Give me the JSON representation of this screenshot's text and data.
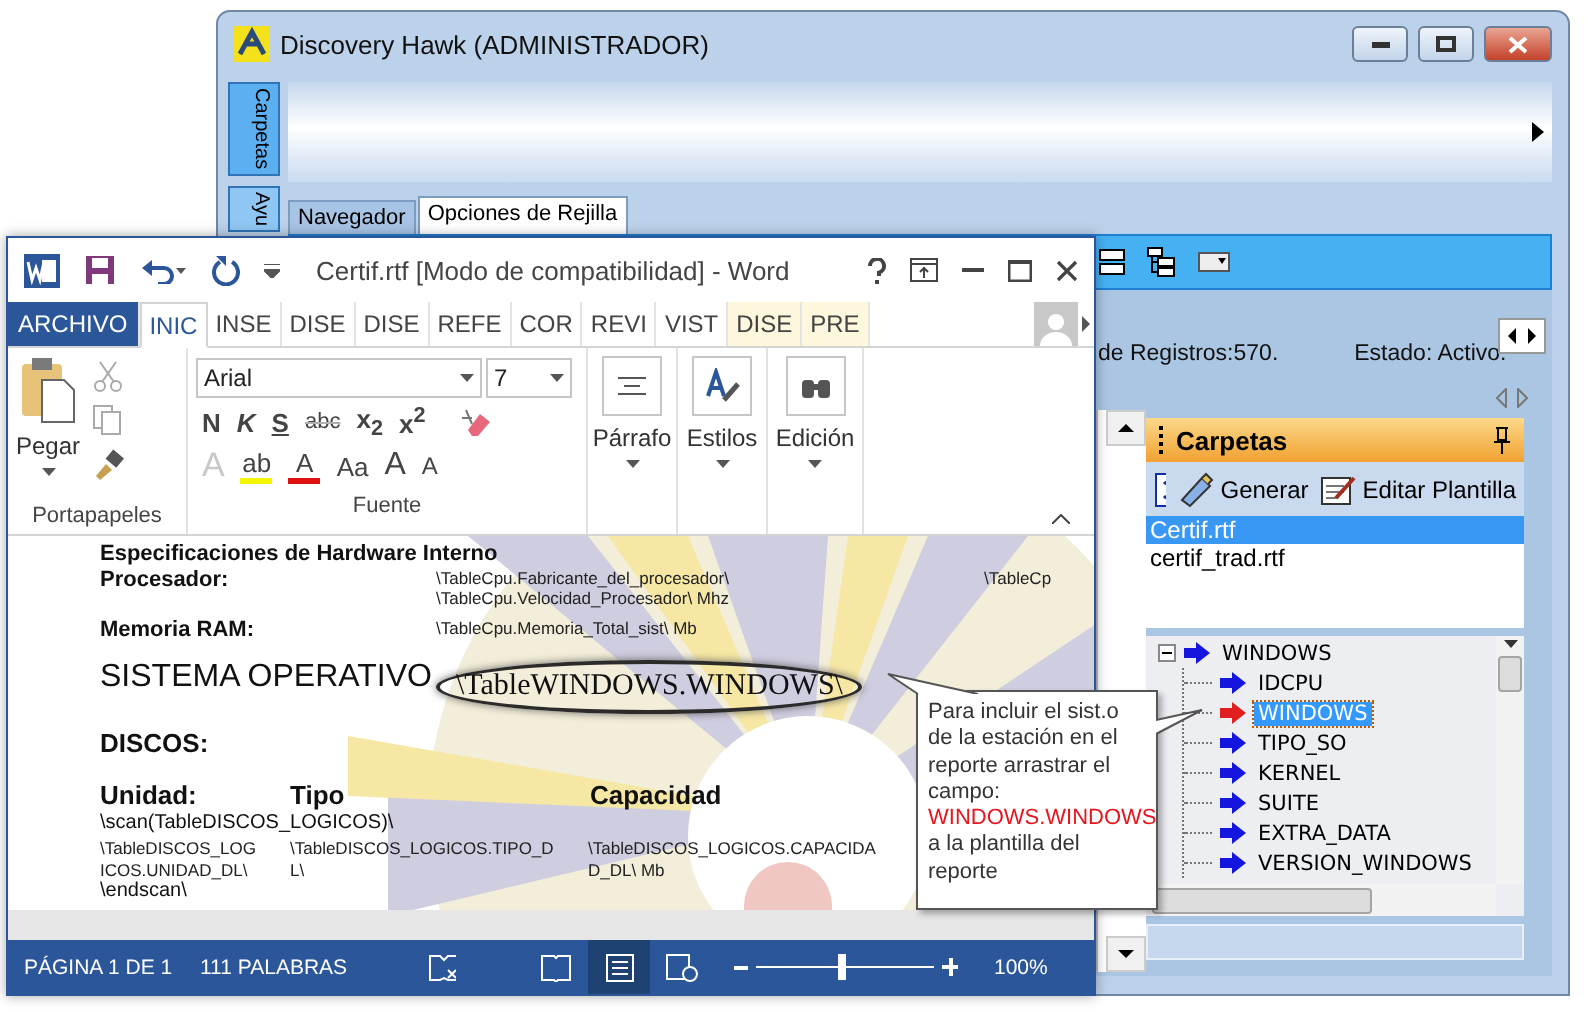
{
  "main_window": {
    "title": "Discovery Hawk (ADMINISTRADOR)",
    "side_tabs": [
      {
        "label": "Carpetas",
        "selected": true
      },
      {
        "label": "Ayu",
        "selected": false
      }
    ],
    "tabs": [
      {
        "label": "Navegador",
        "selected": false
      },
      {
        "label": "Opciones de Rejilla",
        "selected": true
      }
    ],
    "status": [
      "de Registros:570.",
      "Estado: Activo."
    ],
    "carpetas": {
      "title": "Carpetas",
      "actions": [
        "Generar",
        "Editar Plantilla"
      ],
      "files": [
        {
          "name": "Certif.rtf",
          "selected": true
        },
        {
          "name": "certif_trad.rtf",
          "selected": false
        }
      ],
      "tree": {
        "label": "WINDOWS",
        "expanded": true,
        "children": [
          {
            "label": "IDCPU",
            "selected": false
          },
          {
            "label": "WINDOWS",
            "selected": true
          },
          {
            "label": "TIPO_SO",
            "selected": false
          },
          {
            "label": "KERNEL",
            "selected": false
          },
          {
            "label": "SUITE",
            "selected": false
          },
          {
            "label": "EXTRA_DATA",
            "selected": false
          },
          {
            "label": "VERSION_WINDOWS",
            "selected": false
          }
        ]
      }
    }
  },
  "word_window": {
    "title": "Certif.rtf [Modo de compatibilidad] - Word",
    "tabs": [
      {
        "label": "ARCHIVO",
        "kind": "file",
        "selected": false
      },
      {
        "label": "INIC",
        "kind": "normal",
        "selected": true
      },
      {
        "label": "INSE",
        "kind": "normal",
        "selected": false
      },
      {
        "label": "DISE",
        "kind": "normal",
        "selected": false
      },
      {
        "label": "DISE",
        "kind": "normal",
        "selected": false
      },
      {
        "label": "REFE",
        "kind": "normal",
        "selected": false
      },
      {
        "label": "COR",
        "kind": "normal",
        "selected": false
      },
      {
        "label": "REVI",
        "kind": "normal",
        "selected": false
      },
      {
        "label": "VIST",
        "kind": "normal",
        "selected": false
      },
      {
        "label": "DISE",
        "kind": "contextual",
        "selected": false
      },
      {
        "label": "PRE",
        "kind": "contextual",
        "selected": false
      }
    ],
    "ribbon": {
      "paste_label": "Pegar",
      "clipboard_group": "Portapapeles",
      "font": "Arial",
      "size": "7",
      "format_buttons": [
        {
          "label": "N",
          "kind": "bold"
        },
        {
          "label": "K",
          "kind": "italic"
        },
        {
          "label": "S",
          "kind": "underline"
        },
        {
          "label": "abc",
          "kind": "strike"
        },
        {
          "label": "x$_{2}$",
          "kind": "sub"
        },
        {
          "label": "x$^{2}$",
          "kind": "sup"
        }
      ],
      "effect_buttons": [
        {
          "label": "A",
          "kind": "effects",
          "disabled": true
        },
        {
          "label": "ab",
          "kind": "highlight",
          "disabled": false
        },
        {
          "label": "A",
          "kind": "color",
          "disabled": false
        },
        {
          "label": "Aa",
          "kind": "case",
          "disabled": false
        },
        {
          "label": "A",
          "kind": "grow",
          "disabled": false
        },
        {
          "label": "A",
          "kind": "shrink",
          "disabled": false
        }
      ],
      "font_group": "Fuente",
      "big_groups": [
        {
          "label": "Párrafo",
          "kind": "paragraph"
        },
        {
          "label": "Estilos",
          "kind": "styles"
        },
        {
          "label": "Edición",
          "kind": "editing"
        }
      ]
    },
    "document": {
      "heading": "Especificaciones de Hardware Interno",
      "processor_label": "Procesador:",
      "processor_fields": [
        "\\TableCpu.Fabricante_del_procesador\\",
        "\\TableCpu.Velocidad_Procesador\\ Mhz"
      ],
      "processor_extra": "\\TableCp",
      "ram_label": "Memoria RAM:",
      "ram_field": "\\TableCpu.Memoria_Total_sist\\ Mb",
      "os_label": "SISTEMA OPERATIVO",
      "os_field": "\\TableWINDOWS.WINDOWS\\",
      "disks_label": "DISCOS:",
      "disk_columns": [
        "Unidad:",
        "Tipo",
        "Capacidad"
      ],
      "scan_start": "\\scan(TableDISCOS_LOGICOS)\\",
      "disk_fields": [
        "\\TableDISCOS_LOGICOS.UNIDAD_DL\\",
        "\\TableDISCOS_LOGICOS.TIPO_DL\\",
        "\\TableDISCOS_LOGICOS.CAPACIDAD_DL\\ Mb"
      ],
      "scan_end": "\\endscan\\"
    },
    "status_bar": {
      "page": "PÁGINA 1 DE 1",
      "words": "111 PALABRAS",
      "level": 0.48,
      "zoom": "100%"
    }
  },
  "callout": {
    "before": "Para incluir el sist.o de la estación en el reporte arrastrar el campo:",
    "highlight": "WINDOWS.WINDOWS",
    "after": "a la plantilla del reporte"
  }
}
